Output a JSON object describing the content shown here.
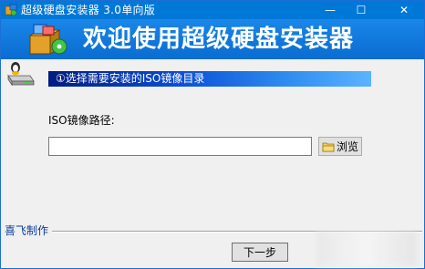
{
  "window": {
    "title": "超级硬盘安装器 3.0单向版",
    "controls": {
      "minimize": "—",
      "maximize": "☐",
      "close": "✕"
    }
  },
  "banner": {
    "title": "欢迎使用超级硬盘安装器"
  },
  "step": {
    "text": "①选择需要安装的ISO镜像目录"
  },
  "iso": {
    "label": "ISO镜像路径:",
    "value": ""
  },
  "browse": {
    "label": "浏览",
    "icon": "folder-icon"
  },
  "footer": {
    "author": "喜飞制作",
    "next_label": "下一步"
  },
  "colors": {
    "titlebar": "#0078d7",
    "banner": "#1a87e8",
    "step_gradient_start": "#001c80",
    "step_gradient_end": "#5cb3ff",
    "author_text": "#0a3c9e"
  }
}
